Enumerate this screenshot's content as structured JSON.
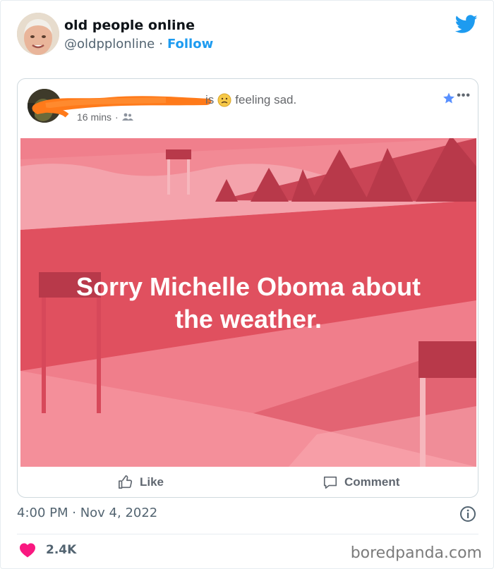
{
  "tweet": {
    "author_name": "old people online",
    "author_handle": "@oldpplonline",
    "separator": "·",
    "follow_label": "Follow",
    "timestamp": "4:00 PM · Nov 4, 2022",
    "like_count": "2.4K"
  },
  "fb_post": {
    "status_is": "is",
    "feeling_text": "feeling sad.",
    "time_ago": "16 mins",
    "time_separator": "·",
    "more_label": "•••",
    "banner_line1": "Sorry Michelle Oboma about",
    "banner_line2": "the weather.",
    "like_label": "Like",
    "comment_label": "Comment"
  },
  "watermark": "boredpanda.com",
  "colors": {
    "twitter_blue": "#1d9bf0",
    "heart": "#f91880",
    "banner_base": "#e0505f",
    "redaction": "#ff7a1a"
  },
  "icons": {
    "bird": "twitter-bird-icon",
    "info": "info-icon",
    "heart": "heart-icon",
    "like": "thumbs-up-icon",
    "comment": "comment-icon",
    "star": "star-icon",
    "friends": "friends-icon",
    "emoji": "sad-face-emoji-icon"
  }
}
